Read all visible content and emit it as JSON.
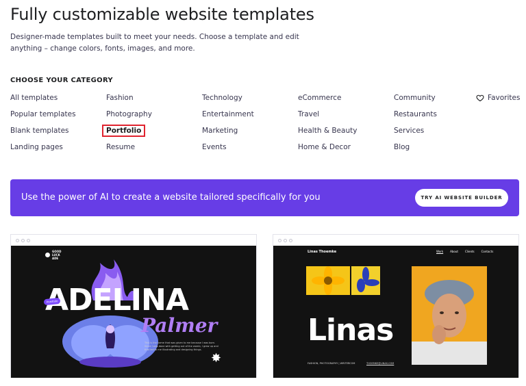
{
  "header": {
    "title": "Fully customizable website templates",
    "subtitle": "Designer-made templates built to meet your needs. Choose a template and edit anything – change colors, fonts, images, and more."
  },
  "categories": {
    "heading": "CHOOSE YOUR CATEGORY",
    "columns": [
      [
        "All templates",
        "Popular templates",
        "Blank templates",
        "Landing pages"
      ],
      [
        "Fashion",
        "Photography",
        "Portfolio",
        "Resume"
      ],
      [
        "Technology",
        "Entertainment",
        "Marketing",
        "Events"
      ],
      [
        "eCommerce",
        "Travel",
        "Health & Beauty",
        "Home & Decor"
      ],
      [
        "Community",
        "Restaurants",
        "Services",
        "Blog"
      ]
    ],
    "selected": "Portfolio",
    "favorites_label": "Favorites",
    "favorites_icon": "heart-outline-icon"
  },
  "banner": {
    "text": "Use the power of AI to create a website tailored specifically for you",
    "button_label": "TRY AI WEBSITE BUILDER",
    "bg_color": "#673de6"
  },
  "templates": [
    {
      "logo_text": "GOOD LUCK ADE",
      "name_text": "ADELINA",
      "surname_text": "Palmer",
      "tag_text": "Portfolio",
      "desc_text": "This is the name that was given to me because I was born. Since I was done with getting out of the womb, I grew up and that led to me illustrating and designing things."
    },
    {
      "brand_text": "Linas Thoemke",
      "nav": [
        "Work",
        "About",
        "Clients",
        "Contacts"
      ],
      "big_text": "Linas",
      "footer_left": "FASHION, PHOTOGRAPHY | WRITERCOM",
      "footer_right": "THOEMKE@LINAS.COM"
    }
  ]
}
